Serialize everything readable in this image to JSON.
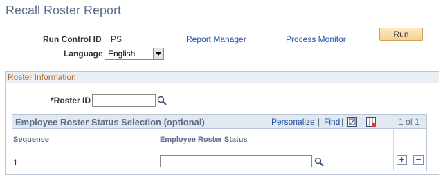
{
  "page": {
    "title": "Recall Roster Report"
  },
  "run_control": {
    "label": "Run Control ID",
    "value": "PS",
    "report_manager": "Report Manager",
    "process_monitor": "Process Monitor",
    "run_button": "Run",
    "language_label": "Language",
    "language_value": "English"
  },
  "roster_info": {
    "title": "Roster Information",
    "roster_id_label": "*Roster ID",
    "roster_id_value": ""
  },
  "status_grid": {
    "title": "Employee Roster Status Selection (optional)",
    "personalize": "Personalize",
    "separator": "|",
    "find": "Find",
    "pagination": "1 of 1",
    "columns": [
      "Sequence",
      "Employee Roster Status"
    ],
    "rows": [
      {
        "sequence": "1",
        "status": ""
      }
    ]
  },
  "icons": {
    "lookup": "magnifier-icon",
    "view_all": "view-all-icon",
    "download": "download-icon",
    "add_row": "plus-icon",
    "delete_row": "minus-icon"
  },
  "colors": {
    "title": "#5a6d8c",
    "link": "#1f4fa6",
    "group_title": "#b26a2e",
    "header_bg": "#e2e8f0",
    "border": "#b9c6d8",
    "run_button": "#f6d38f"
  }
}
